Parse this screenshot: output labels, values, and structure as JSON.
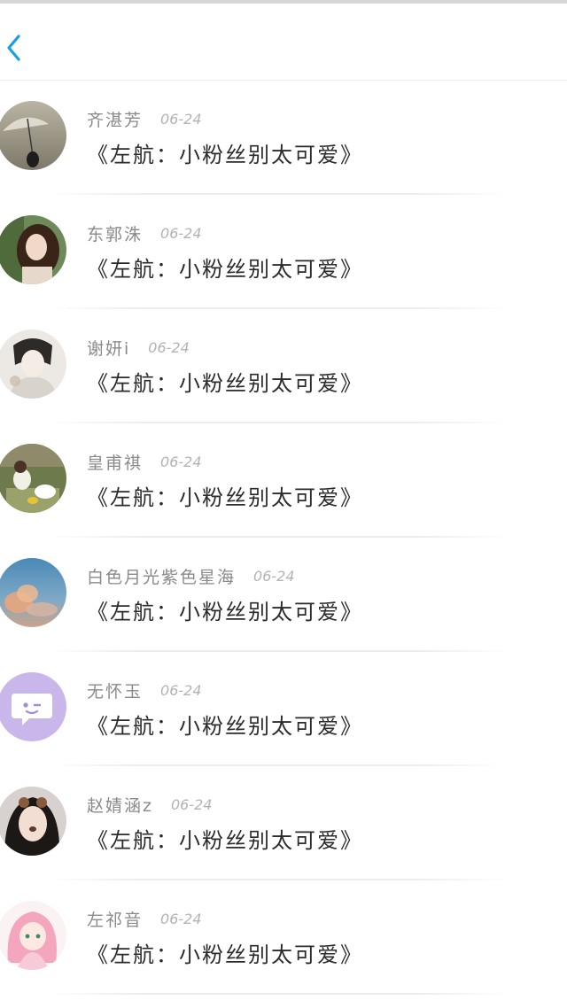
{
  "header": {
    "back_icon": "chevron-left-icon",
    "accent_color": "#1a9ee6"
  },
  "comments": [
    {
      "name": "齐湛芳",
      "date": "06-24",
      "text": "《左航：小粉丝别太可爱》",
      "avatar": "umbrella-photo"
    },
    {
      "name": "东郭洙",
      "date": "06-24",
      "text": "《左航：小粉丝别太可爱》",
      "avatar": "girl-photo"
    },
    {
      "name": "谢妍i",
      "date": "06-24",
      "text": "《左航：小粉丝别太可爱》",
      "avatar": "girl-sketch-photo"
    },
    {
      "name": "皇甫祺",
      "date": "06-24",
      "text": "《左航：小粉丝别太可爱》",
      "avatar": "cartoon-ducks"
    },
    {
      "name": "白色月光紫色星海",
      "date": "06-24",
      "text": "《左航：小粉丝别太可爱》",
      "avatar": "sky-clouds"
    },
    {
      "name": "无怀玉",
      "date": "06-24",
      "text": "《左航：小粉丝别太可爱》",
      "avatar": "default-chat-avatar"
    },
    {
      "name": "赵婧涵z",
      "date": "06-24",
      "text": "《左航：小粉丝别太可爱》",
      "avatar": "selfie-photo"
    },
    {
      "name": "左祁音",
      "date": "06-24",
      "text": "《左航：小粉丝别太可爱》",
      "avatar": "anime-pink-girl"
    }
  ]
}
